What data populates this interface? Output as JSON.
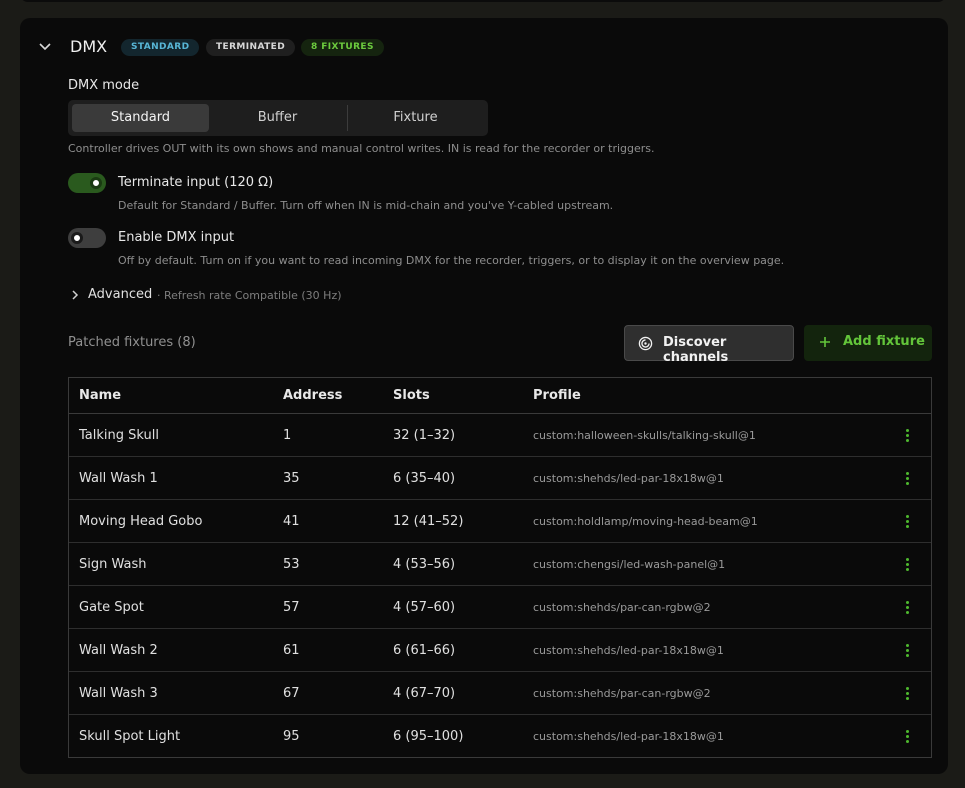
{
  "section": {
    "title": "DMX",
    "badges": {
      "standard": "STANDARD",
      "terminated": "TERMINATED",
      "fixtures": "8 FIXTURES"
    }
  },
  "mode": {
    "label": "DMX mode",
    "options": [
      "Standard",
      "Buffer",
      "Fixture"
    ],
    "selected": "Standard",
    "description": "Controller drives OUT with its own shows and manual control writes. IN is read for the recorder or triggers."
  },
  "toggles": [
    {
      "label": "Terminate input (120 Ω)",
      "description": "Default for Standard / Buffer. Turn off when IN is mid-chain and you've Y-cabled upstream.",
      "on": true
    },
    {
      "label": "Enable DMX input",
      "description": "Off by default. Turn on if you want to read incoming DMX for the recorder, triggers, or to display it on the overview page.",
      "on": false
    }
  ],
  "advanced": {
    "label": "Advanced",
    "summary": "· Refresh rate Compatible (30 Hz)"
  },
  "fixtures": {
    "patched_label": "Patched fixtures (8)",
    "discover_label": "Discover channels",
    "add_label": "Add fixture",
    "columns": [
      "Name",
      "Address",
      "Slots",
      "Profile"
    ],
    "rows": [
      {
        "name": "Talking Skull",
        "address": "1",
        "slots": "32 (1–32)",
        "profile": "custom:halloween-skulls/talking-skull@1"
      },
      {
        "name": "Wall Wash 1",
        "address": "35",
        "slots": "6 (35–40)",
        "profile": "custom:shehds/led-par-18x18w@1"
      },
      {
        "name": "Moving Head Gobo",
        "address": "41",
        "slots": "12 (41–52)",
        "profile": "custom:holdlamp/moving-head-beam@1"
      },
      {
        "name": "Sign Wash",
        "address": "53",
        "slots": "4 (53–56)",
        "profile": "custom:chengsi/led-wash-panel@1"
      },
      {
        "name": "Gate Spot",
        "address": "57",
        "slots": "4 (57–60)",
        "profile": "custom:shehds/par-can-rgbw@2"
      },
      {
        "name": "Wall Wash 2",
        "address": "61",
        "slots": "6 (61–66)",
        "profile": "custom:shehds/led-par-18x18w@1"
      },
      {
        "name": "Wall Wash 3",
        "address": "67",
        "slots": "4 (67–70)",
        "profile": "custom:shehds/par-can-rgbw@2"
      },
      {
        "name": "Skull Spot Light",
        "address": "95",
        "slots": "6 (95–100)",
        "profile": "custom:shehds/led-par-18x18w@1"
      }
    ]
  },
  "icons": {
    "collapse": "chevron-down-icon",
    "advanced": "chevron-right-icon",
    "discover": "radar-icon",
    "add": "plus-icon",
    "row_menu": "kebab-menu-icon"
  },
  "colors": {
    "accent_green": "#63c53a",
    "badge_blue": "#58b6d6",
    "toggle_on": "#2a5a1e"
  }
}
